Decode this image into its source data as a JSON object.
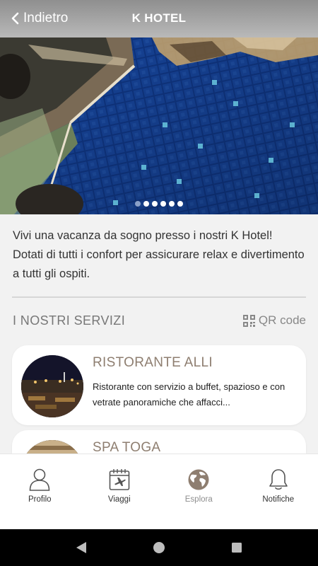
{
  "header": {
    "back_label": "Indietro",
    "title": "K HOTEL"
  },
  "hero": {
    "slide_count": 6,
    "active_index": 0
  },
  "description": "Vivi una vacanza da sogno presso i nostri K Hotel! Dotati di tutti i confort per assicurare relax e divertimento a tutti gli ospiti.",
  "services": {
    "title": "I NOSTRI SERVIZI",
    "qr_label": "QR code",
    "items": [
      {
        "title": "RISTORANTE ALLI",
        "description": "Ristorante con servizio a buffet, spazioso e con vetrate panoramiche che affacci..."
      },
      {
        "title": "SPA TOGA",
        "description": ""
      }
    ]
  },
  "tabbar": {
    "items": [
      {
        "label": "Profilo",
        "icon": "user-icon"
      },
      {
        "label": "Viaggi",
        "icon": "calendar-plane-icon"
      },
      {
        "label": "Esplora",
        "icon": "globe-icon"
      },
      {
        "label": "Notifiche",
        "icon": "bell-icon"
      }
    ],
    "active": "Esplora"
  },
  "colors": {
    "header": "#9e9e9e",
    "accent": "#8e7e70",
    "pool_blue": "#123f9a"
  }
}
